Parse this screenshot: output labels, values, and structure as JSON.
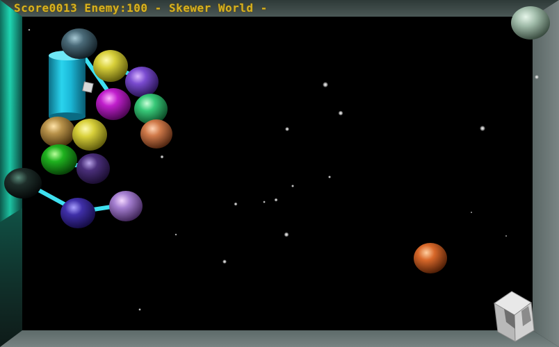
{
  "hud": {
    "score_label": "Score",
    "score_value": "0013",
    "enemy_label": "Enemy:",
    "enemy_value": "100",
    "separator": " - ",
    "world_name": "Skewer World",
    "trailing": " -"
  },
  "colors": {
    "hud_text": "#d9b21f",
    "frame_top": "#3f4a48",
    "frame_left_glow": "#1fd6b2",
    "skewer_link": "#3fe0f0",
    "cannon": "#1fb6d6"
  },
  "icons": {
    "cannon": "cyan-cylinder-cannon",
    "navigation": "rotation-cube-icon"
  }
}
